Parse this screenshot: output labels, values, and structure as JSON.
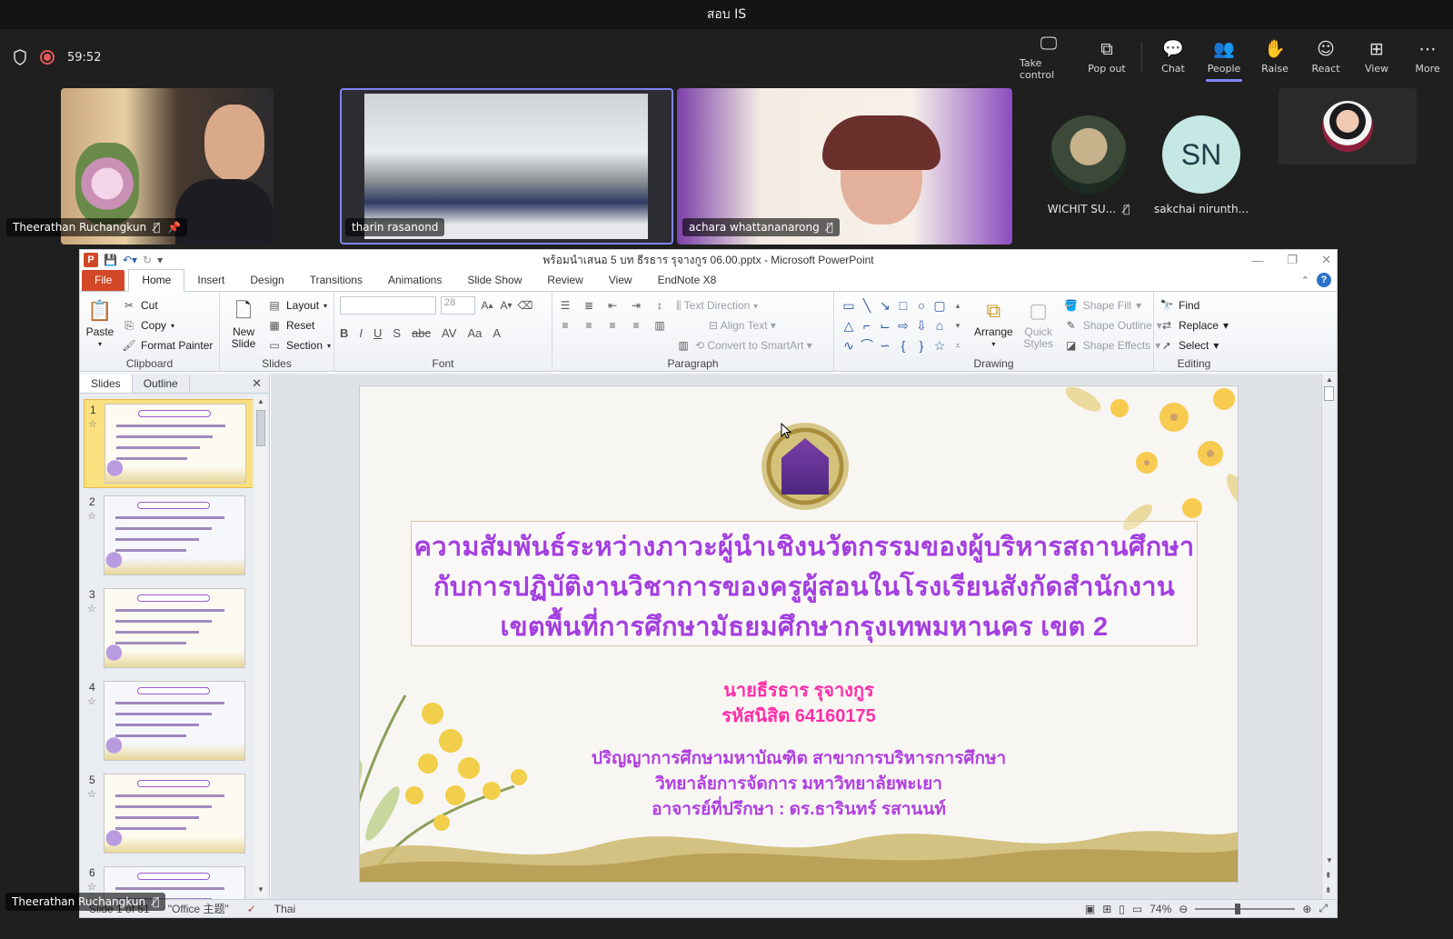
{
  "window": {
    "title": "สอบ IS"
  },
  "meeting": {
    "timer": "59:52",
    "controls": [
      {
        "label": "Take control",
        "icon": "take-control-icon",
        "glyph": "🖵"
      },
      {
        "label": "Pop out",
        "icon": "pop-out-icon",
        "glyph": "⧉"
      },
      {
        "label": "Chat",
        "icon": "chat-icon",
        "glyph": "💬"
      },
      {
        "label": "People",
        "icon": "people-icon",
        "glyph": "👥"
      },
      {
        "label": "Raise",
        "icon": "raise-hand-icon",
        "glyph": "✋"
      },
      {
        "label": "React",
        "icon": "react-icon",
        "glyph": "☺"
      },
      {
        "label": "View",
        "icon": "view-icon",
        "glyph": "⊞"
      },
      {
        "label": "More",
        "icon": "more-icon",
        "glyph": "⋯"
      }
    ],
    "active_control": "People",
    "accent": "#7f85f5"
  },
  "participants": [
    {
      "name": "Theerathan Ruchangkun"
    },
    {
      "name": "tharin rasanond"
    },
    {
      "name": "achara whattananarong"
    },
    {
      "name": "WICHIT SU..."
    },
    {
      "name": "sakchai nirunth...",
      "initials": "SN"
    }
  ],
  "powerpoint": {
    "doc_title": "พร้อมนำเสนอ 5 บท ธีรธาร  รุจางกูร 06.00.pptx  -  Microsoft PowerPoint",
    "tabs": [
      "File",
      "Home",
      "Insert",
      "Design",
      "Transitions",
      "Animations",
      "Slide Show",
      "Review",
      "View",
      "EndNote X8"
    ],
    "active_tab": "Home",
    "ribbon": {
      "clipboard": {
        "label": "Clipboard",
        "paste": "Paste",
        "cut": "Cut",
        "copy": "Copy",
        "format_painter": "Format Painter"
      },
      "slides": {
        "label": "Slides",
        "new_slide": "New Slide",
        "layout": "Layout",
        "reset": "Reset",
        "section": "Section"
      },
      "font": {
        "label": "Font",
        "size": "28"
      },
      "paragraph": {
        "label": "Paragraph",
        "text_direction": "Text Direction",
        "align_text": "Align Text",
        "convert": "Convert to SmartArt"
      },
      "drawing": {
        "label": "Drawing",
        "arrange": "Arrange",
        "quick_styles": "Quick Styles",
        "shape_fill": "Shape Fill",
        "shape_outline": "Shape Outline",
        "shape_effects": "Shape Effects"
      },
      "editing": {
        "label": "Editing",
        "find": "Find",
        "replace": "Replace",
        "select": "Select"
      }
    },
    "panel": {
      "tabs": [
        "Slides",
        "Outline"
      ],
      "slide_numbers": [
        "1",
        "2",
        "3",
        "4",
        "5",
        "6"
      ]
    },
    "slide": {
      "title_lines": [
        "ความสัมพันธ์ระหว่างภาวะผู้นำเชิงนวัตกรรมของผู้บริหารสถานศึกษา",
        "กับการปฏิบัติงานวิชาการของครูผู้สอนในโรงเรียนสังกัดสำนักงาน",
        "เขตพื้นที่การศึกษามัธยมศึกษากรุงเทพมหานคร เขต 2"
      ],
      "author": "นายธีรธาร   รุจางกูร",
      "student_id": "รหัสนิสิต   64160175",
      "degree": "ปริญญาการศึกษามหาบัณฑิต  สาขาการบริหารการศึกษา",
      "college": "วิทยาลัยการจัดการ  มหาวิทยาลัยพะเยา",
      "advisor": "อาจารย์ที่ปรึกษา : ดร.ธารินทร์   รสานนท์"
    },
    "status": {
      "slide_of": "Slide 1 of 51",
      "theme": "\"Office 主题\"",
      "language": "Thai",
      "zoom": "74%"
    }
  }
}
